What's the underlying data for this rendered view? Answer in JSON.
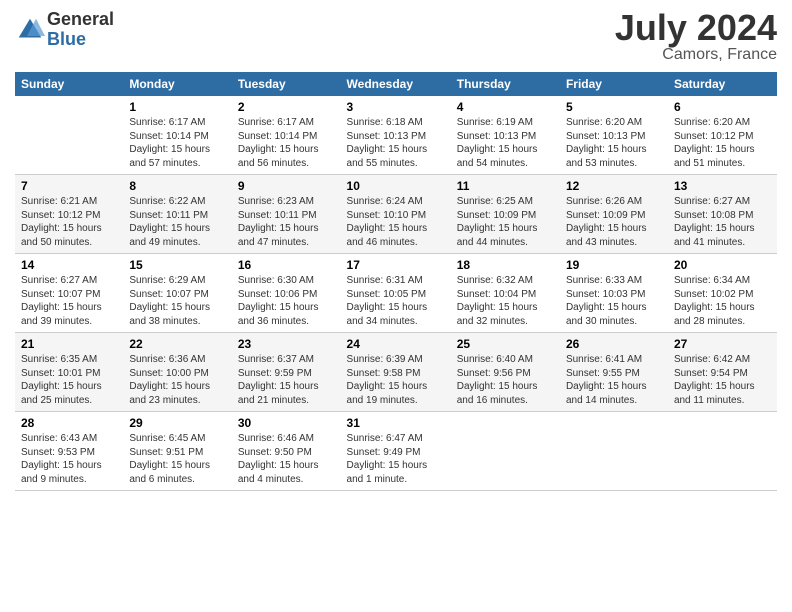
{
  "header": {
    "logo_general": "General",
    "logo_blue": "Blue",
    "month_title": "July 2024",
    "location": "Camors, France"
  },
  "calendar": {
    "headers": [
      "Sunday",
      "Monday",
      "Tuesday",
      "Wednesday",
      "Thursday",
      "Friday",
      "Saturday"
    ],
    "weeks": [
      [
        {
          "day": "",
          "info": ""
        },
        {
          "day": "1",
          "info": "Sunrise: 6:17 AM\nSunset: 10:14 PM\nDaylight: 15 hours\nand 57 minutes."
        },
        {
          "day": "2",
          "info": "Sunrise: 6:17 AM\nSunset: 10:14 PM\nDaylight: 15 hours\nand 56 minutes."
        },
        {
          "day": "3",
          "info": "Sunrise: 6:18 AM\nSunset: 10:13 PM\nDaylight: 15 hours\nand 55 minutes."
        },
        {
          "day": "4",
          "info": "Sunrise: 6:19 AM\nSunset: 10:13 PM\nDaylight: 15 hours\nand 54 minutes."
        },
        {
          "day": "5",
          "info": "Sunrise: 6:20 AM\nSunset: 10:13 PM\nDaylight: 15 hours\nand 53 minutes."
        },
        {
          "day": "6",
          "info": "Sunrise: 6:20 AM\nSunset: 10:12 PM\nDaylight: 15 hours\nand 51 minutes."
        }
      ],
      [
        {
          "day": "7",
          "info": "Sunrise: 6:21 AM\nSunset: 10:12 PM\nDaylight: 15 hours\nand 50 minutes."
        },
        {
          "day": "8",
          "info": "Sunrise: 6:22 AM\nSunset: 10:11 PM\nDaylight: 15 hours\nand 49 minutes."
        },
        {
          "day": "9",
          "info": "Sunrise: 6:23 AM\nSunset: 10:11 PM\nDaylight: 15 hours\nand 47 minutes."
        },
        {
          "day": "10",
          "info": "Sunrise: 6:24 AM\nSunset: 10:10 PM\nDaylight: 15 hours\nand 46 minutes."
        },
        {
          "day": "11",
          "info": "Sunrise: 6:25 AM\nSunset: 10:09 PM\nDaylight: 15 hours\nand 44 minutes."
        },
        {
          "day": "12",
          "info": "Sunrise: 6:26 AM\nSunset: 10:09 PM\nDaylight: 15 hours\nand 43 minutes."
        },
        {
          "day": "13",
          "info": "Sunrise: 6:27 AM\nSunset: 10:08 PM\nDaylight: 15 hours\nand 41 minutes."
        }
      ],
      [
        {
          "day": "14",
          "info": "Sunrise: 6:27 AM\nSunset: 10:07 PM\nDaylight: 15 hours\nand 39 minutes."
        },
        {
          "day": "15",
          "info": "Sunrise: 6:29 AM\nSunset: 10:07 PM\nDaylight: 15 hours\nand 38 minutes."
        },
        {
          "day": "16",
          "info": "Sunrise: 6:30 AM\nSunset: 10:06 PM\nDaylight: 15 hours\nand 36 minutes."
        },
        {
          "day": "17",
          "info": "Sunrise: 6:31 AM\nSunset: 10:05 PM\nDaylight: 15 hours\nand 34 minutes."
        },
        {
          "day": "18",
          "info": "Sunrise: 6:32 AM\nSunset: 10:04 PM\nDaylight: 15 hours\nand 32 minutes."
        },
        {
          "day": "19",
          "info": "Sunrise: 6:33 AM\nSunset: 10:03 PM\nDaylight: 15 hours\nand 30 minutes."
        },
        {
          "day": "20",
          "info": "Sunrise: 6:34 AM\nSunset: 10:02 PM\nDaylight: 15 hours\nand 28 minutes."
        }
      ],
      [
        {
          "day": "21",
          "info": "Sunrise: 6:35 AM\nSunset: 10:01 PM\nDaylight: 15 hours\nand 25 minutes."
        },
        {
          "day": "22",
          "info": "Sunrise: 6:36 AM\nSunset: 10:00 PM\nDaylight: 15 hours\nand 23 minutes."
        },
        {
          "day": "23",
          "info": "Sunrise: 6:37 AM\nSunset: 9:59 PM\nDaylight: 15 hours\nand 21 minutes."
        },
        {
          "day": "24",
          "info": "Sunrise: 6:39 AM\nSunset: 9:58 PM\nDaylight: 15 hours\nand 19 minutes."
        },
        {
          "day": "25",
          "info": "Sunrise: 6:40 AM\nSunset: 9:56 PM\nDaylight: 15 hours\nand 16 minutes."
        },
        {
          "day": "26",
          "info": "Sunrise: 6:41 AM\nSunset: 9:55 PM\nDaylight: 15 hours\nand 14 minutes."
        },
        {
          "day": "27",
          "info": "Sunrise: 6:42 AM\nSunset: 9:54 PM\nDaylight: 15 hours\nand 11 minutes."
        }
      ],
      [
        {
          "day": "28",
          "info": "Sunrise: 6:43 AM\nSunset: 9:53 PM\nDaylight: 15 hours\nand 9 minutes."
        },
        {
          "day": "29",
          "info": "Sunrise: 6:45 AM\nSunset: 9:51 PM\nDaylight: 15 hours\nand 6 minutes."
        },
        {
          "day": "30",
          "info": "Sunrise: 6:46 AM\nSunset: 9:50 PM\nDaylight: 15 hours\nand 4 minutes."
        },
        {
          "day": "31",
          "info": "Sunrise: 6:47 AM\nSunset: 9:49 PM\nDaylight: 15 hours\nand 1 minute."
        },
        {
          "day": "",
          "info": ""
        },
        {
          "day": "",
          "info": ""
        },
        {
          "day": "",
          "info": ""
        }
      ]
    ]
  }
}
